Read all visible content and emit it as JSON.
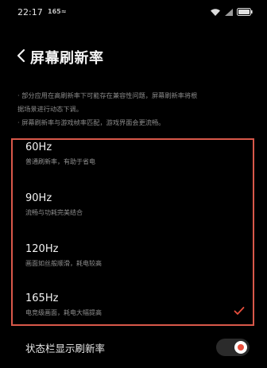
{
  "status_bar": {
    "time": "22:17",
    "refresh_indicator": "165≈",
    "icons": [
      "wifi-icon",
      "signal-icon",
      "battery-icon"
    ]
  },
  "header": {
    "title": "屏幕刷新率",
    "back_icon": "chevron-left-icon"
  },
  "notes": [
    "· 部分应用在高刷新率下可能存在兼容性问题，屏幕刷新率将根",
    "据场景进行动态下调。",
    "· 屏幕刷新率与游戏帧率匹配，游戏界面会更流畅。"
  ],
  "options": [
    {
      "label": "60Hz",
      "description": "普通刷新率，有助于省电",
      "selected": false
    },
    {
      "label": "90Hz",
      "description": "流畅与功耗完美结合",
      "selected": false
    },
    {
      "label": "120Hz",
      "description": "画面如丝般顺滑，耗电较高",
      "selected": false
    },
    {
      "label": "165Hz",
      "description": "电竞级画面，耗电大幅提高",
      "selected": true
    }
  ],
  "statusbar_setting": {
    "label": "状态栏显示刷新率",
    "enabled": true
  },
  "colors": {
    "accent": "#e84f3d",
    "highlight_frame": "#d9584a",
    "background": "#000000"
  }
}
